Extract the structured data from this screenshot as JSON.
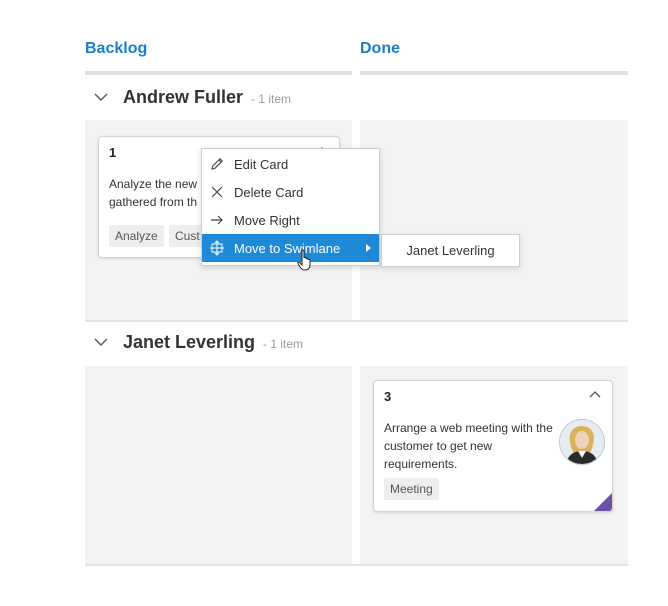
{
  "columns": [
    {
      "label": "Backlog"
    },
    {
      "label": "Done"
    }
  ],
  "swimlanes": [
    {
      "name": "Andrew Fuller",
      "count": "- 1 item"
    },
    {
      "name": "Janet Leverling",
      "count": "- 1 item"
    }
  ],
  "cards": [
    {
      "id": "1",
      "text_line1": "Analyze the new r",
      "text_line2": "gathered from th",
      "tags": [
        "Analyze",
        "Cust"
      ]
    },
    {
      "id": "3",
      "text_line1": "Arrange a web meeting with the",
      "text_line2": "customer to get new",
      "text_line3": "requirements.",
      "tags": [
        "Meeting"
      ]
    }
  ],
  "context_menu": {
    "items": [
      {
        "label": "Edit Card",
        "icon": "pencil-icon"
      },
      {
        "label": "Delete Card",
        "icon": "close-icon"
      },
      {
        "label": "Move Right",
        "icon": "arrow-right-icon"
      },
      {
        "label": "Move to Swimlane",
        "icon": "move-icon"
      }
    ],
    "submenu": [
      "Janet Leverling"
    ]
  },
  "colors": {
    "header": "#1a7fc8",
    "active": "#1d8ad8",
    "cell": "#f3f3f3",
    "corner": "#6a51a3"
  }
}
